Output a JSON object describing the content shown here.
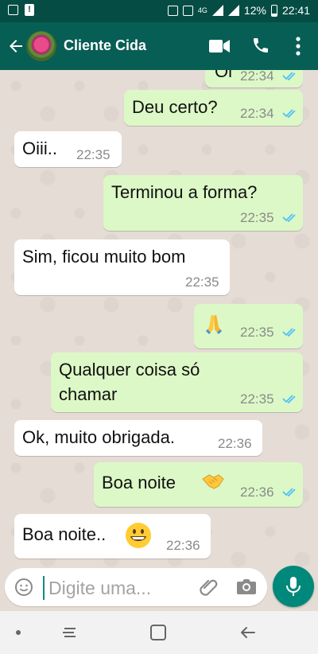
{
  "status_bar": {
    "network": "4G",
    "battery": "12%",
    "time": "22:41"
  },
  "header": {
    "contact_name": "Cliente Cida"
  },
  "messages": [
    {
      "text": "Oi",
      "time": "22:34",
      "direction": "out",
      "read": true
    },
    {
      "text": "Deu certo?",
      "time": "22:34",
      "direction": "out",
      "read": true
    },
    {
      "text": "Oiii..",
      "time": "22:35",
      "direction": "in"
    },
    {
      "text": "Terminou  a forma?",
      "time": "22:35",
      "direction": "out",
      "read": true
    },
    {
      "text": "Sim, ficou muito bom",
      "time": "22:35",
      "direction": "in"
    },
    {
      "text": "",
      "emoji": "folded-hands",
      "time": "22:35",
      "direction": "out",
      "read": true
    },
    {
      "text_line1": "Qualquer coisa só",
      "text_line2": "chamar",
      "time": "22:35",
      "direction": "out",
      "read": true
    },
    {
      "text": "Ok, muito obrigada.",
      "time": "22:36",
      "direction": "in"
    },
    {
      "text": "Boa  noite",
      "emoji": "handshake",
      "time": "22:36",
      "direction": "out",
      "read": true
    },
    {
      "text": "Boa noite..",
      "emoji": "grinning-face",
      "time": "22:36",
      "direction": "in"
    }
  ],
  "composer": {
    "placeholder": "Digite uma..."
  },
  "colors": {
    "header": "#075e54",
    "status_bar": "#054d44",
    "outgoing_bubble": "#dcf8c6",
    "incoming_bubble": "#ffffff",
    "read_tick": "#4fc3f7",
    "mic_button": "#00897b"
  }
}
